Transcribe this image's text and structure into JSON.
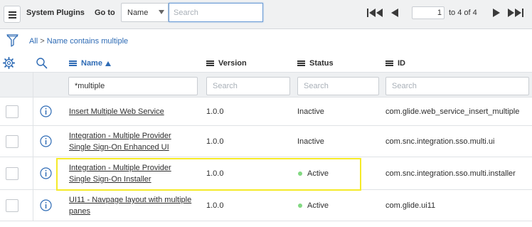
{
  "header": {
    "title": "System Plugins",
    "goto_label": "Go to",
    "field_select_value": "Name",
    "search_placeholder": "Search",
    "page_current": "1",
    "page_total": "to 4 of 4"
  },
  "breadcrumb": {
    "all": "All",
    "separator": ">",
    "condition": "Name contains multiple"
  },
  "columns": {
    "name": "Name",
    "version": "Version",
    "status": "Status",
    "id": "ID"
  },
  "filters": {
    "name_value": "*multiple",
    "version_placeholder": "Search",
    "status_placeholder": "Search",
    "id_placeholder": "Search"
  },
  "rows": [
    {
      "name_line1": "Insert Multiple Web Service",
      "name_line2": "",
      "version": "1.0.0",
      "status": "Inactive",
      "id": "com.glide.web_service_insert_multiple"
    },
    {
      "name_line1": "Integration - Multiple Provider",
      "name_line2": "Single Sign-On Enhanced UI",
      "version": "1.0.0",
      "status": "Inactive",
      "id": "com.snc.integration.sso.multi.ui"
    },
    {
      "name_line1": "Integration - Multiple Provider",
      "name_line2": "Single Sign-On Installer",
      "version": "1.0.0",
      "status": "Active",
      "id": "com.snc.integration.sso.multi.installer"
    },
    {
      "name_line1": "UI11 - Navpage layout with multiple",
      "name_line2": "panes",
      "version": "1.0.0",
      "status": "Active",
      "id": "com.glide.ui11"
    }
  ],
  "colors": {
    "link": "#2e6bb5",
    "active_dot": "#82d882",
    "highlight": "#f5ea29"
  },
  "icons": [
    "hamburger-menu-icon",
    "caret-down-icon",
    "first-page-icon",
    "previous-page-icon",
    "next-page-icon",
    "last-page-icon",
    "funnel-filter-icon",
    "gear-icon",
    "search-icon",
    "info-icon",
    "sort-ascending-icon"
  ]
}
